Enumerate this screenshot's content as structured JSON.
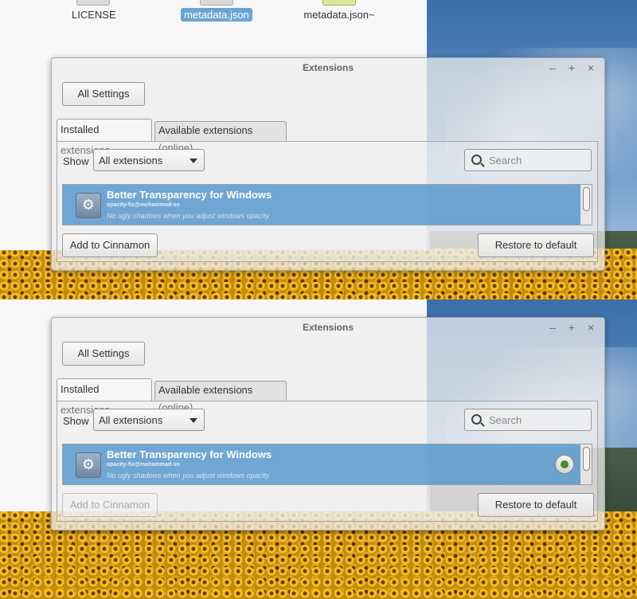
{
  "files": [
    "LICENSE",
    "metadata.json",
    "metadata.json~"
  ],
  "windows": [
    {
      "title": "Extensions",
      "controls": {
        "minimize": "–",
        "maximize": "+",
        "close": "×"
      },
      "all_settings": "All Settings",
      "tabs": [
        "Installed extensions",
        "Available extensions (online)"
      ],
      "show_label": "Show",
      "show_value": "All extensions",
      "search_placeholder": "Search",
      "extension": {
        "name": "Better Transparency for Windows",
        "uuid": "opacity-fix@mohammad-sn",
        "description": "No ugly shadows when you adjust windows opacity"
      },
      "add_button": "Add to Cinnamon",
      "restore_button": "Restore to default"
    },
    {
      "title": "Extensions",
      "controls": {
        "minimize": "–",
        "maximize": "+",
        "close": "×"
      },
      "all_settings": "All Settings",
      "tabs": [
        "Installed extensions",
        "Available extensions (online)"
      ],
      "show_label": "Show",
      "show_value": "All extensions",
      "search_placeholder": "Search",
      "extension": {
        "name": "Better Transparency for Windows",
        "uuid": "opacity-fix@mohammad-sn",
        "description": "No ugly shadows when you adjust windows opacity"
      },
      "add_button": "Add to Cinnamon",
      "restore_button": "Restore to default"
    }
  ],
  "icons": {
    "extension": "gear-icon",
    "search": "search-icon",
    "active_indicator": "active-radio-indicator"
  }
}
